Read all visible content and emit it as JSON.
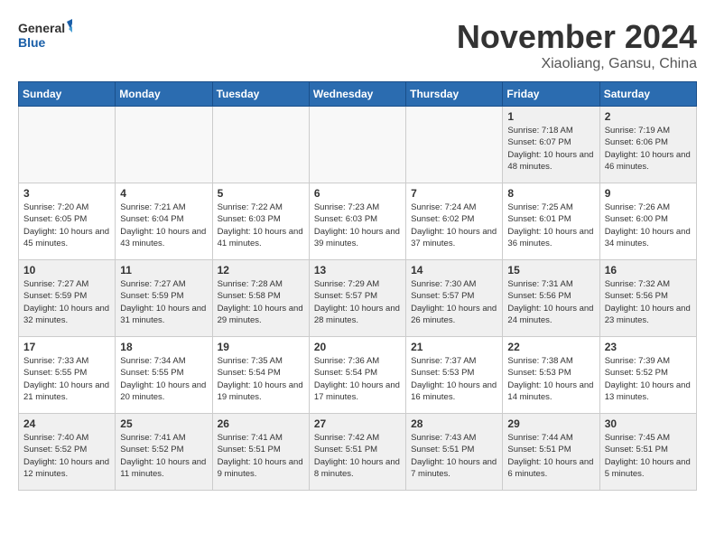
{
  "header": {
    "logo_general": "General",
    "logo_blue": "Blue",
    "month_title": "November 2024",
    "location": "Xiaoliang, Gansu, China"
  },
  "days_of_week": [
    "Sunday",
    "Monday",
    "Tuesday",
    "Wednesday",
    "Thursday",
    "Friday",
    "Saturday"
  ],
  "weeks": [
    [
      {
        "day": "",
        "info": "",
        "empty": true
      },
      {
        "day": "",
        "info": "",
        "empty": true
      },
      {
        "day": "",
        "info": "",
        "empty": true
      },
      {
        "day": "",
        "info": "",
        "empty": true
      },
      {
        "day": "",
        "info": "",
        "empty": true
      },
      {
        "day": "1",
        "info": "Sunrise: 7:18 AM\nSunset: 6:07 PM\nDaylight: 10 hours and 48 minutes."
      },
      {
        "day": "2",
        "info": "Sunrise: 7:19 AM\nSunset: 6:06 PM\nDaylight: 10 hours and 46 minutes."
      }
    ],
    [
      {
        "day": "3",
        "info": "Sunrise: 7:20 AM\nSunset: 6:05 PM\nDaylight: 10 hours and 45 minutes."
      },
      {
        "day": "4",
        "info": "Sunrise: 7:21 AM\nSunset: 6:04 PM\nDaylight: 10 hours and 43 minutes."
      },
      {
        "day": "5",
        "info": "Sunrise: 7:22 AM\nSunset: 6:03 PM\nDaylight: 10 hours and 41 minutes."
      },
      {
        "day": "6",
        "info": "Sunrise: 7:23 AM\nSunset: 6:03 PM\nDaylight: 10 hours and 39 minutes."
      },
      {
        "day": "7",
        "info": "Sunrise: 7:24 AM\nSunset: 6:02 PM\nDaylight: 10 hours and 37 minutes."
      },
      {
        "day": "8",
        "info": "Sunrise: 7:25 AM\nSunset: 6:01 PM\nDaylight: 10 hours and 36 minutes."
      },
      {
        "day": "9",
        "info": "Sunrise: 7:26 AM\nSunset: 6:00 PM\nDaylight: 10 hours and 34 minutes."
      }
    ],
    [
      {
        "day": "10",
        "info": "Sunrise: 7:27 AM\nSunset: 5:59 PM\nDaylight: 10 hours and 32 minutes."
      },
      {
        "day": "11",
        "info": "Sunrise: 7:27 AM\nSunset: 5:59 PM\nDaylight: 10 hours and 31 minutes."
      },
      {
        "day": "12",
        "info": "Sunrise: 7:28 AM\nSunset: 5:58 PM\nDaylight: 10 hours and 29 minutes."
      },
      {
        "day": "13",
        "info": "Sunrise: 7:29 AM\nSunset: 5:57 PM\nDaylight: 10 hours and 28 minutes."
      },
      {
        "day": "14",
        "info": "Sunrise: 7:30 AM\nSunset: 5:57 PM\nDaylight: 10 hours and 26 minutes."
      },
      {
        "day": "15",
        "info": "Sunrise: 7:31 AM\nSunset: 5:56 PM\nDaylight: 10 hours and 24 minutes."
      },
      {
        "day": "16",
        "info": "Sunrise: 7:32 AM\nSunset: 5:56 PM\nDaylight: 10 hours and 23 minutes."
      }
    ],
    [
      {
        "day": "17",
        "info": "Sunrise: 7:33 AM\nSunset: 5:55 PM\nDaylight: 10 hours and 21 minutes."
      },
      {
        "day": "18",
        "info": "Sunrise: 7:34 AM\nSunset: 5:55 PM\nDaylight: 10 hours and 20 minutes."
      },
      {
        "day": "19",
        "info": "Sunrise: 7:35 AM\nSunset: 5:54 PM\nDaylight: 10 hours and 19 minutes."
      },
      {
        "day": "20",
        "info": "Sunrise: 7:36 AM\nSunset: 5:54 PM\nDaylight: 10 hours and 17 minutes."
      },
      {
        "day": "21",
        "info": "Sunrise: 7:37 AM\nSunset: 5:53 PM\nDaylight: 10 hours and 16 minutes."
      },
      {
        "day": "22",
        "info": "Sunrise: 7:38 AM\nSunset: 5:53 PM\nDaylight: 10 hours and 14 minutes."
      },
      {
        "day": "23",
        "info": "Sunrise: 7:39 AM\nSunset: 5:52 PM\nDaylight: 10 hours and 13 minutes."
      }
    ],
    [
      {
        "day": "24",
        "info": "Sunrise: 7:40 AM\nSunset: 5:52 PM\nDaylight: 10 hours and 12 minutes."
      },
      {
        "day": "25",
        "info": "Sunrise: 7:41 AM\nSunset: 5:52 PM\nDaylight: 10 hours and 11 minutes."
      },
      {
        "day": "26",
        "info": "Sunrise: 7:41 AM\nSunset: 5:51 PM\nDaylight: 10 hours and 9 minutes."
      },
      {
        "day": "27",
        "info": "Sunrise: 7:42 AM\nSunset: 5:51 PM\nDaylight: 10 hours and 8 minutes."
      },
      {
        "day": "28",
        "info": "Sunrise: 7:43 AM\nSunset: 5:51 PM\nDaylight: 10 hours and 7 minutes."
      },
      {
        "day": "29",
        "info": "Sunrise: 7:44 AM\nSunset: 5:51 PM\nDaylight: 10 hours and 6 minutes."
      },
      {
        "day": "30",
        "info": "Sunrise: 7:45 AM\nSunset: 5:51 PM\nDaylight: 10 hours and 5 minutes."
      }
    ]
  ]
}
